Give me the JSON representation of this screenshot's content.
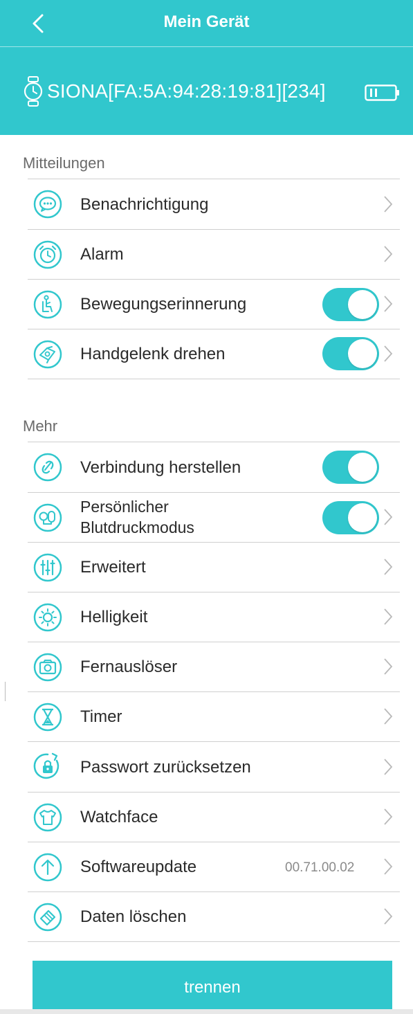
{
  "header": {
    "title": "Mein Gerät",
    "back_icon": "chevron-left-icon",
    "device_name": "SIONA[FA:5A:94:28:19:81][234]",
    "device_icon": "watch-icon",
    "battery_icon": "battery-icon",
    "accent_color": "#31c7cd"
  },
  "sections": [
    {
      "title": "Mitteilungen"
    },
    {
      "title": "Mehr"
    }
  ],
  "items": [
    {
      "label": "Benachrichtigung",
      "icon": "message-icon",
      "control": "chevron"
    },
    {
      "label": "Alarm",
      "icon": "alarm-clock-icon",
      "control": "chevron"
    },
    {
      "label": "Bewegungserinnerung",
      "icon": "sedentary-reminder-icon",
      "control": "toggle",
      "toggle_on": true
    },
    {
      "label": "Handgelenk drehen",
      "icon": "wrist-turn-icon",
      "control": "toggle",
      "toggle_on": true
    },
    {
      "label": "Verbindung herstellen",
      "icon": "link-icon",
      "control": "toggle",
      "toggle_on": true
    },
    {
      "label_line1": "Persönlicher",
      "label_line2": "Blutdruckmodus",
      "icon": "blood-pressure-icon",
      "control": "toggle",
      "toggle_on": true
    },
    {
      "label": "Erweitert",
      "icon": "sliders-icon",
      "control": "chevron"
    },
    {
      "label": "Helligkeit",
      "icon": "brightness-icon",
      "control": "chevron"
    },
    {
      "label": "Fernauslöser",
      "icon": "camera-icon",
      "control": "chevron"
    },
    {
      "label": "Timer",
      "icon": "hourglass-icon",
      "control": "chevron"
    },
    {
      "label": "Passwort zurücksetzen",
      "icon": "lock-reset-icon",
      "control": "chevron"
    },
    {
      "label": "Watchface",
      "icon": "shirt-icon",
      "control": "chevron"
    },
    {
      "label": "Softwareupdate",
      "icon": "arrow-up-icon",
      "control": "chevron",
      "value": "00.71.00.02"
    },
    {
      "label": "Daten löschen",
      "icon": "eraser-icon",
      "control": "chevron"
    }
  ],
  "disconnect_button": {
    "label": "trennen"
  }
}
